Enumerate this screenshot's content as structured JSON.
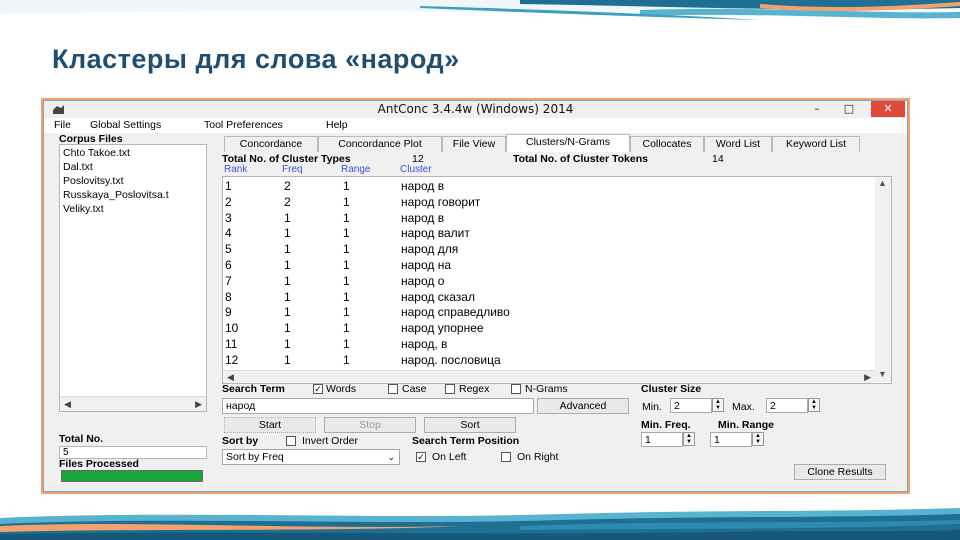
{
  "slide": {
    "title": "Кластеры для слова «народ»"
  },
  "window": {
    "title": "AntConc 3.4.4w (Windows) 2014",
    "minimize": "–",
    "maximize": "□",
    "close": "✕"
  },
  "menu": [
    "File",
    "Global Settings",
    "Tool Preferences",
    "Help"
  ],
  "corpus": {
    "heading": "Corpus Files",
    "files": [
      "Chto Takoe.txt",
      "Dal.txt",
      "Poslovitsy.txt",
      "Russkaya_Poslovitsa.t",
      "Veliky.txt"
    ],
    "total_label": "Total No.",
    "total_value": "5",
    "processed_label": "Files Processed",
    "progress": 1.0
  },
  "tabs": [
    "Concordance",
    "Concordance Plot",
    "File View",
    "Clusters/N-Grams",
    "Collocates",
    "Word List",
    "Keyword List"
  ],
  "active_tab": "Clusters/N-Grams",
  "stats": {
    "types_label": "Total No. of Cluster Types",
    "types_value": "12",
    "tokens_label": "Total No. of Cluster Tokens",
    "tokens_value": "14"
  },
  "columns": [
    "Rank",
    "Freq",
    "Range",
    "Cluster"
  ],
  "rows": [
    {
      "rank": "1",
      "freq": "2",
      "range": "1",
      "cluster": "народ в"
    },
    {
      "rank": "2",
      "freq": "2",
      "range": "1",
      "cluster": "народ говорит"
    },
    {
      "rank": "3",
      "freq": "1",
      "range": "1",
      "cluster": "народ    в"
    },
    {
      "rank": "4",
      "freq": "1",
      "range": "1",
      "cluster": "народ валит"
    },
    {
      "rank": "5",
      "freq": "1",
      "range": "1",
      "cluster": "народ для"
    },
    {
      "rank": "6",
      "freq": "1",
      "range": "1",
      "cluster": "народ на"
    },
    {
      "rank": "7",
      "freq": "1",
      "range": "1",
      "cluster": "народ о"
    },
    {
      "rank": "8",
      "freq": "1",
      "range": "1",
      "cluster": "народ сказал"
    },
    {
      "rank": "9",
      "freq": "1",
      "range": "1",
      "cluster": "народ справедливо"
    },
    {
      "rank": "10",
      "freq": "1",
      "range": "1",
      "cluster": "народ упорнее"
    },
    {
      "rank": "11",
      "freq": "1",
      "range": "1",
      "cluster": "народ, в"
    },
    {
      "rank": "12",
      "freq": "1",
      "range": "1",
      "cluster": "народ. пословица"
    }
  ],
  "search": {
    "label": "Search Term",
    "words": "Words",
    "case": "Case",
    "regex": "Regex",
    "ngrams": "N-Grams",
    "value": "народ",
    "advanced": "Advanced",
    "start": "Start",
    "stop": "Stop",
    "sort": "Sort"
  },
  "cluster_size": {
    "label": "Cluster Size",
    "min_label": "Min.",
    "min_value": "2",
    "max_label": "Max.",
    "max_value": "2"
  },
  "min_freq": {
    "label": "Min. Freq.",
    "value": "1"
  },
  "min_range": {
    "label": "Min. Range",
    "value": "1"
  },
  "sort_by": {
    "label": "Sort by",
    "invert": "Invert Order",
    "selected": "Sort by Freq"
  },
  "position": {
    "label": "Search Term Position",
    "left": "On Left",
    "right": "On Right"
  },
  "clone": "Clone Results",
  "colors": {
    "accent_orange": "#f3a26b",
    "title_blue": "#1f4e70",
    "progress_green": "#18a53a",
    "header_blue": "#3a52d8"
  }
}
